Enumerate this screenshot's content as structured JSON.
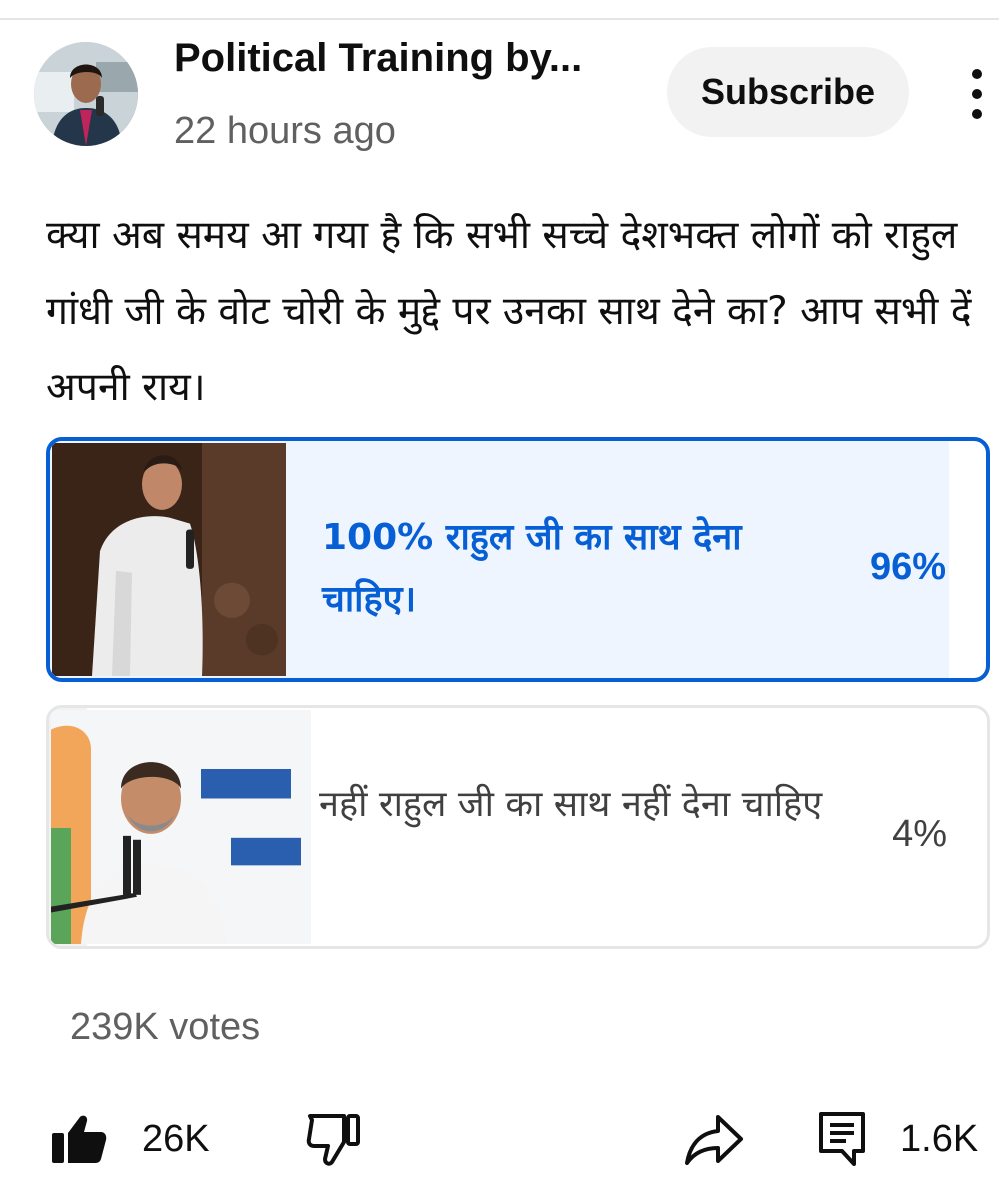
{
  "channel": {
    "name": "Political Training by...",
    "time": "22 hours ago",
    "subscribe_label": "Subscribe",
    "avatar_icon": "channel-avatar",
    "menu_icon": "more-vert-icon"
  },
  "post": {
    "question": "क्या अब समय आ गया है कि सभी सच्चे देशभक्त लोगों को राहुल गांधी जी के वोट चोरी के मुद्दे पर उनका साथ देने का? आप सभी दें अपनी राय।"
  },
  "poll": {
    "options": [
      {
        "text": "100% राहुल जी का साथ देना चाहिए।",
        "percent": "96%",
        "fraction": 0.96,
        "selected": true
      },
      {
        "text": "नहीं राहुल जी का साथ नहीं देना चाहिए",
        "percent": "4%",
        "fraction": 0.04,
        "selected": false
      }
    ],
    "votes": "239K votes"
  },
  "actions": {
    "likes": "26K",
    "comments": "1.6K",
    "like_icon": "thumb-up-filled-icon",
    "dislike_icon": "thumb-down-outline-icon",
    "share_icon": "share-icon",
    "comment_icon": "comment-icon"
  },
  "colors": {
    "accent": "#065fd4",
    "selected_fill": "#eef5fe",
    "muted_text": "#606060",
    "button_bg": "#f2f2f2"
  }
}
